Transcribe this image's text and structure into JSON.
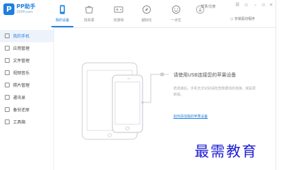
{
  "app": {
    "logo_glyph": "P",
    "name": "PP助手",
    "subtitle": "25PP.com"
  },
  "tabs": [
    {
      "label": "我的设备",
      "icon": "phone-icon",
      "active": true
    },
    {
      "label": "找资源",
      "icon": "store-icon",
      "active": false
    },
    {
      "label": "找游戏",
      "icon": "gamepad-icon",
      "active": false
    },
    {
      "label": "越狱化",
      "icon": "compass-icon",
      "active": false
    },
    {
      "label": "一点生",
      "icon": "smiley-icon",
      "active": false
    },
    {
      "label": "",
      "icon": "download-icon",
      "active": false
    }
  ],
  "account": {
    "label": "登录/注册"
  },
  "install_driver": {
    "label": "安装驱动程序"
  },
  "sidebar": {
    "items": [
      {
        "label": "我的手机",
        "icon": "phone-icon",
        "active": true
      },
      {
        "label": "应用管理",
        "icon": "grid-icon",
        "active": false
      },
      {
        "label": "文件管理",
        "icon": "folder-icon",
        "active": false
      },
      {
        "label": "视频音乐",
        "icon": "video-icon",
        "active": false
      },
      {
        "label": "照片管理",
        "icon": "photo-icon",
        "active": false
      },
      {
        "label": "通讯录",
        "icon": "contacts-icon",
        "active": false
      },
      {
        "label": "备份还原",
        "icon": "backup-icon",
        "active": false
      },
      {
        "label": "工具箱",
        "icon": "toolbox-icon",
        "active": false
      }
    ]
  },
  "main": {
    "headline": "请使用USB连接您的苹果设备",
    "description": "若连接后，手机无法识别请检查数据线的连接，或是更新版。",
    "link": "如何添加我的苹果设备"
  },
  "watermark": "最需教育",
  "colors": {
    "accent": "#1e7fe0",
    "watermark": "#1c1cd4"
  }
}
